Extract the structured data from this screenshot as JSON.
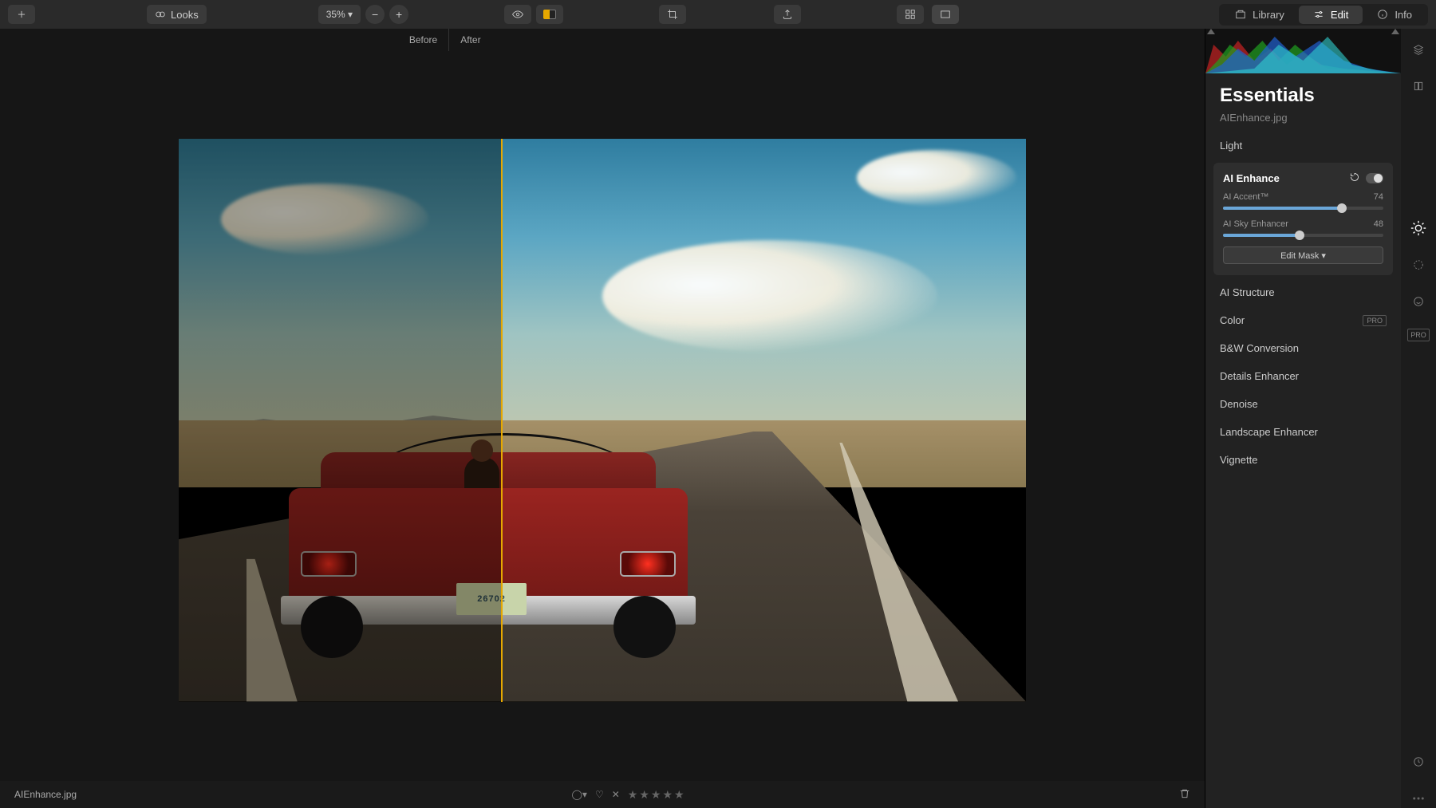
{
  "toolbar": {
    "looks_label": "Looks",
    "zoom_label": "35% ▾",
    "tabs": {
      "library": "Library",
      "edit": "Edit",
      "info": "Info"
    }
  },
  "compare": {
    "before_label": "Before",
    "after_label": "After",
    "split_percent": 38
  },
  "photo": {
    "plate": "26702"
  },
  "status": {
    "filename": "AIEnhance.jpg"
  },
  "panel": {
    "title": "Essentials",
    "filename": "AIEnhance.jpg",
    "sections": {
      "light": "Light",
      "ai_enhance": "AI Enhance",
      "ai_structure": "AI Structure",
      "color": "Color",
      "bw": "B&W Conversion",
      "details": "Details Enhancer",
      "denoise": "Denoise",
      "landscape": "Landscape Enhancer",
      "vignette": "Vignette"
    },
    "pro_label": "PRO",
    "ai_enhance": {
      "accent_label": "AI Accent™",
      "accent_value": 74,
      "sky_label": "AI Sky Enhancer",
      "sky_value": 48,
      "mask_button": "Edit Mask ▾"
    }
  }
}
